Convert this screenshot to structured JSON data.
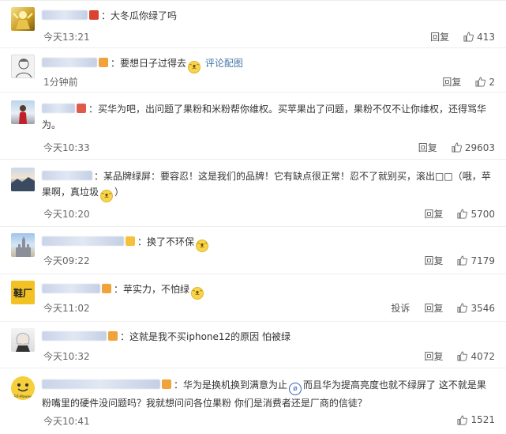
{
  "comments": [
    {
      "user": "",
      "badge_color": "#d9432f",
      "text": "大冬瓜你绿了吗",
      "emoji": false,
      "extra_text": "",
      "link": "",
      "time": "今天13:21",
      "reply": "回复",
      "report": "",
      "likes": "413"
    },
    {
      "user": "",
      "badge_color": "#f0a33a",
      "text": "要想日子过得去",
      "emoji": true,
      "extra_text": "",
      "link": "评论配图",
      "time": "1分钟前",
      "reply": "回复",
      "report": "",
      "likes": "2"
    },
    {
      "user": "",
      "badge_color": "#e05a4a",
      "text": "买华为吧，出问题了果粉和米粉帮你维权。买苹果出了问题，果粉不仅不让你维权，还得骂华为。",
      "emoji": false,
      "extra_text": "",
      "link": "",
      "time": "今天10:33",
      "reply": "回复",
      "report": "",
      "likes": "29603"
    },
    {
      "user": "",
      "badge_color": "",
      "text": "某品牌绿屏：要容忍！这是我们的品牌！它有缺点很正常！忍不了就别买，滚出□□（哦，苹果啊，真垃圾",
      "emoji": true,
      "extra_text": "）",
      "link": "",
      "time": "今天10:20",
      "reply": "回复",
      "report": "",
      "likes": "5700"
    },
    {
      "user": "",
      "badge_color": "#f3c23a",
      "text": "换了不环保",
      "emoji": true,
      "extra_text": "",
      "link": "",
      "time": "今天09:22",
      "reply": "回复",
      "report": "",
      "likes": "7179"
    },
    {
      "user": "",
      "badge_color": "#f0a33a",
      "text": "苹实力，不怕绿",
      "emoji": true,
      "extra_text": "",
      "link": "",
      "time": "今天11:02",
      "reply": "回复",
      "report": "投诉",
      "likes": "3546"
    },
    {
      "user": "",
      "badge_color": "#f0a33a",
      "text": "这就是我不买iphone12的原因 怕被绿",
      "emoji": false,
      "extra_text": "",
      "link": "",
      "time": "今天10:32",
      "reply": "回复",
      "report": "",
      "likes": "4072"
    },
    {
      "user": "",
      "badge_color": "#f0a33a",
      "text": "华为是换机换到满意为止",
      "emoji": true,
      "extra_text": "而且华为提高亮度也就不绿屏了 这不就是果粉嘴里的硬件没问题吗？我就想问问各位果粉 你们是消费者还是厂商的信徒？",
      "link": "",
      "time": "今天10:41",
      "reply": "回复",
      "report": "",
      "likes": "1521"
    }
  ],
  "avatars": [
    "gold-figure",
    "sketch-portrait",
    "red-person-photo",
    "landscape-photo",
    "castle-photo",
    "yellow-logo",
    "anime-character",
    "emoji-face"
  ],
  "avatar_text": {
    "yellow_logo": "鞋厂",
    "emoji_face": "EIF-Mowies"
  }
}
